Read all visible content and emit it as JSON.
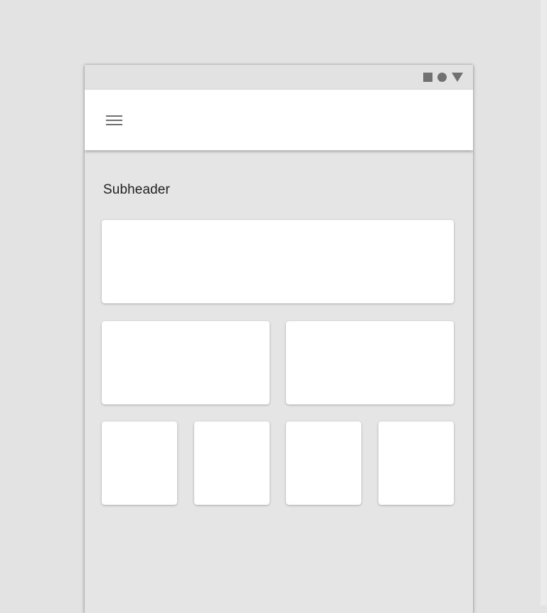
{
  "screen": {
    "subheader": "Subheader"
  },
  "status_bar": {
    "icons": [
      "square-icon",
      "circle-icon",
      "triangle-icon"
    ]
  },
  "app_bar": {
    "menu_icon": "hamburger-menu-icon"
  },
  "cards": {
    "rows": [
      {
        "columns": 1
      },
      {
        "columns": 2
      },
      {
        "columns": 4
      }
    ]
  },
  "colors": {
    "page_background": "#e3e3e3",
    "device_background": "#e5e5e5",
    "status_bar_background": "#e2e2e2",
    "app_bar_background": "#ffffff",
    "card_background": "#ffffff",
    "icon_color": "#717171",
    "subheader_text": "#222222"
  }
}
